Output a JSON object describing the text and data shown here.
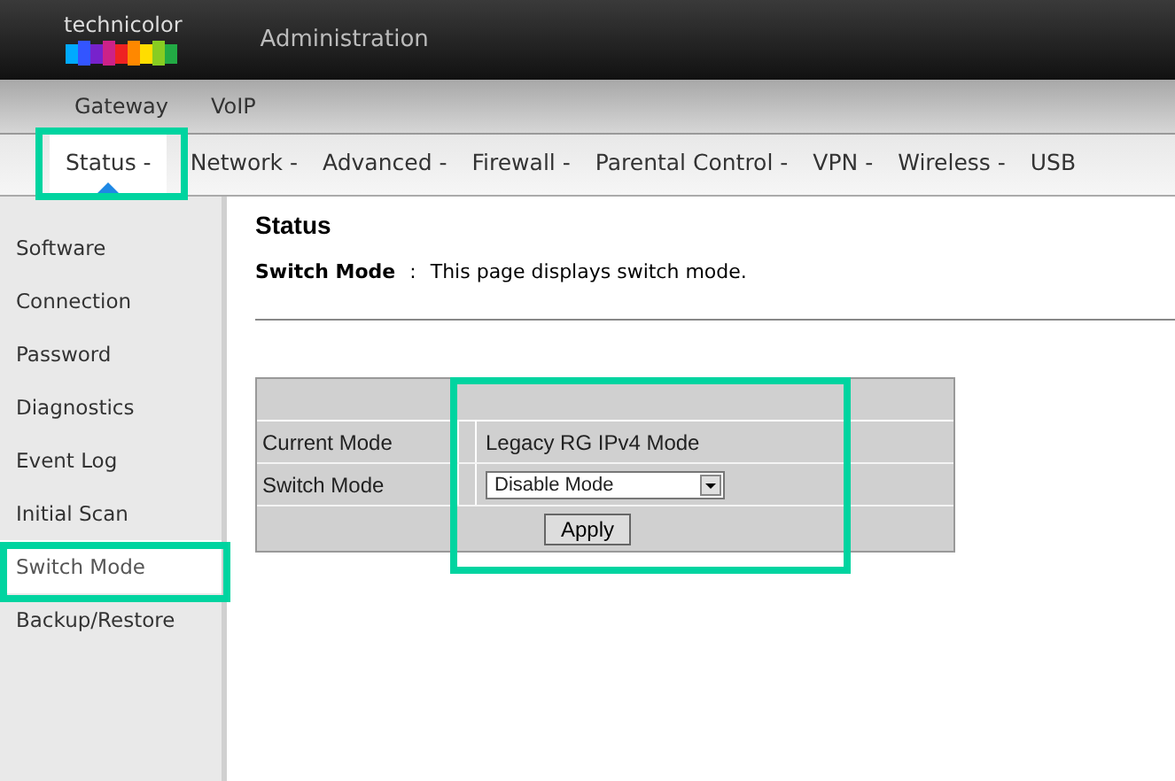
{
  "header": {
    "brand": "technicolor",
    "title": "Administration"
  },
  "top_tabs": [
    {
      "label": "Gateway"
    },
    {
      "label": "VoIP"
    }
  ],
  "menu": [
    {
      "label": "Status -",
      "selected": true
    },
    {
      "label": "Network -",
      "selected": false
    },
    {
      "label": "Advanced -",
      "selected": false
    },
    {
      "label": "Firewall -",
      "selected": false
    },
    {
      "label": "Parental Control -",
      "selected": false
    },
    {
      "label": "VPN -",
      "selected": false
    },
    {
      "label": "Wireless -",
      "selected": false
    },
    {
      "label": "USB",
      "selected": false
    }
  ],
  "sidebar": {
    "items": [
      {
        "label": "Software",
        "selected": false
      },
      {
        "label": "Connection",
        "selected": false
      },
      {
        "label": "Password",
        "selected": false
      },
      {
        "label": "Diagnostics",
        "selected": false
      },
      {
        "label": "Event Log",
        "selected": false
      },
      {
        "label": "Initial Scan",
        "selected": false
      },
      {
        "label": "Switch Mode",
        "selected": true
      },
      {
        "label": "Backup/Restore",
        "selected": false
      }
    ]
  },
  "page": {
    "title": "Status",
    "subtitle_label": "Switch Mode",
    "separator": ":",
    "description": "This page displays switch mode."
  },
  "form": {
    "current_mode_label": "Current Mode",
    "current_mode_value": "Legacy RG IPv4 Mode",
    "switch_mode_label": "Switch Mode",
    "switch_mode_value": "Disable Mode",
    "apply": "Apply"
  }
}
